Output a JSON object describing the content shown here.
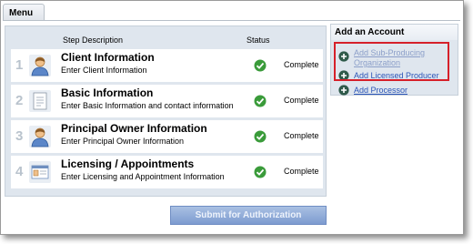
{
  "menu_tab": {
    "label": "Menu"
  },
  "steps": {
    "header_description": "Step Description",
    "header_status": "Status",
    "rows": [
      {
        "number": "1",
        "icon": "person-icon",
        "title": "Client Information",
        "subtitle": "Enter Client Information",
        "status": "Complete"
      },
      {
        "number": "2",
        "icon": "document-icon",
        "title": "Basic Information",
        "subtitle": "Enter Basic Information and contact information",
        "status": "Complete"
      },
      {
        "number": "3",
        "icon": "person-icon",
        "title": "Principal Owner Information",
        "subtitle": "Enter Principal Owner Information",
        "status": "Complete"
      },
      {
        "number": "4",
        "icon": "license-card-icon",
        "title": "Licensing / Appointments",
        "subtitle": "Enter Licensing and Appointment Information",
        "status": "Complete"
      }
    ]
  },
  "submit": {
    "label": "Submit for Authorization"
  },
  "add_account": {
    "title": "Add an Account",
    "items": [
      {
        "line1": "Add Sub-Producing",
        "line2": "Organization"
      },
      {
        "line1": "Add Licensed Producer"
      },
      {
        "line1": "Add Processor"
      }
    ]
  },
  "colors": {
    "panel_bg": "#dfe6ee",
    "check_green": "#3a9b3a",
    "link_blue": "#2c55b7",
    "highlight_red": "#d6202a",
    "submit_blue": "#7d9bd0"
  }
}
